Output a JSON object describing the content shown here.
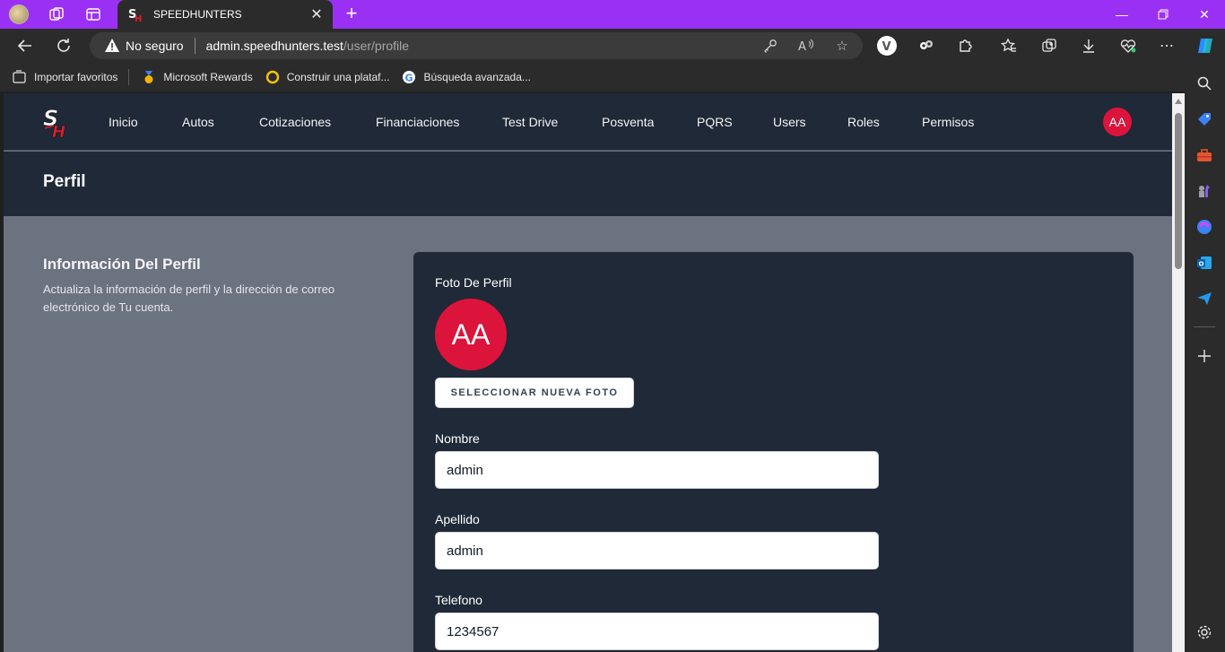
{
  "browser": {
    "tab_title": "SPEEDHUNTERS",
    "address": {
      "security_label": "No seguro",
      "host": "admin.speedhunters.test",
      "path": "/user/profile"
    },
    "favorites": [
      {
        "label": "Importar favoritos",
        "icon": "import-icon"
      },
      {
        "label": "Microsoft Rewards",
        "icon": "rewards-medal-icon"
      },
      {
        "label": "Construir una plataf...",
        "icon": "ring-icon"
      },
      {
        "label": "Búsqueda avanzada...",
        "icon": "google-icon"
      }
    ],
    "accent": "#9b30f5"
  },
  "nav": {
    "links": [
      "Inicio",
      "Autos",
      "Cotizaciones",
      "Financiaciones",
      "Test Drive",
      "Posventa",
      "PQRS",
      "Users",
      "Roles",
      "Permisos"
    ],
    "avatar_initials": "AA"
  },
  "page": {
    "title": "Perfil"
  },
  "profile": {
    "section_title": "Información Del Perfil",
    "section_description": "Actualiza la información de perfil y la dirección de correo electrónico de Tu cuenta.",
    "photo_label": "Foto De Perfil",
    "avatar_initials": "AA",
    "select_photo_button": "SELECCIONAR NUEVA FOTO",
    "fields": [
      {
        "label": "Nombre",
        "value": "admin"
      },
      {
        "label": "Apellido",
        "value": "admin"
      },
      {
        "label": "Telefono",
        "value": "1234567"
      }
    ]
  },
  "colors": {
    "brand_red": "#dc143c",
    "nav_bg": "#1f2937",
    "page_bg": "#6b7280"
  }
}
